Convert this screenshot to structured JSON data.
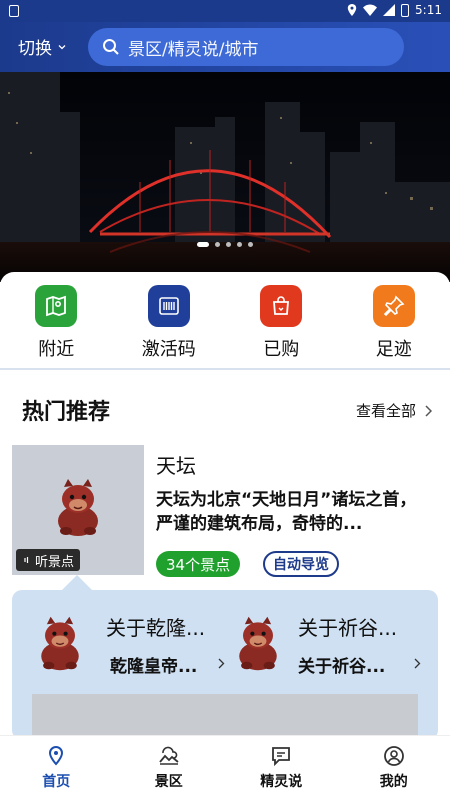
{
  "status_bar": {
    "time": "5:11"
  },
  "header": {
    "switch_label": "切换",
    "search_placeholder": "景区/精灵说/城市"
  },
  "banner": {
    "slide_count": 5,
    "active_slide": 1
  },
  "quick_menu": [
    {
      "label": "附近",
      "icon": "map-icon",
      "color": "#2aa33a"
    },
    {
      "label": "激活码",
      "icon": "barcode-icon",
      "color": "#1f3f9a"
    },
    {
      "label": "已购",
      "icon": "shopping-bag-icon",
      "color": "#e0391e"
    },
    {
      "label": "足迹",
      "icon": "pin-icon",
      "color": "#f07a1c"
    }
  ],
  "recommend": {
    "title": "热门推荐",
    "view_all": "查看全部",
    "item": {
      "name": "天坛",
      "desc": "天坛为北京“天地日月”诸坛之首，严谨的建筑布局，奇特的...",
      "listen_tag": "听景点",
      "spots_tag": "34个景点",
      "guide_tag": "自动导览"
    },
    "sub_items": [
      {
        "title": "关于乾隆...",
        "desc": "乾隆皇帝..."
      },
      {
        "title": "关于祈谷...",
        "desc": "关于祈谷..."
      }
    ]
  },
  "bottom_nav": [
    {
      "label": "首页",
      "icon": "location-icon",
      "active": true
    },
    {
      "label": "景区",
      "icon": "scenery-icon",
      "active": false
    },
    {
      "label": "精灵说",
      "icon": "chat-icon",
      "active": false
    },
    {
      "label": "我的",
      "icon": "user-icon",
      "active": false
    }
  ],
  "colors": {
    "header_bg": "#1c3a8c",
    "search_bg": "#3d6ad6",
    "nav_active": "#1d4fb0",
    "tag_green": "#20a12e",
    "panel_bg": "#cfe0f2"
  }
}
